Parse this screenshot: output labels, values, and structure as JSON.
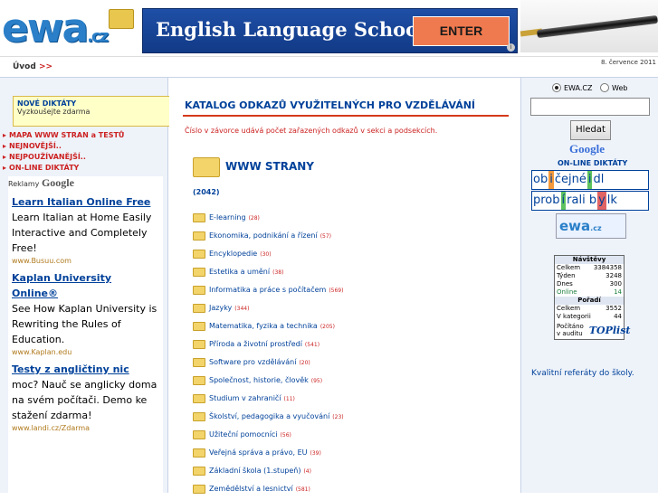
{
  "header": {
    "logo_text": "ewa",
    "logo_suffix": ".cz",
    "banner_title": "English Language School",
    "banner_button": "ENTER",
    "banner_info": "i"
  },
  "subbar": {
    "breadcrumb": "Úvod",
    "breadcrumb_arrows": ">>",
    "date": "8. července 2011"
  },
  "left": {
    "promo_title": "NOVÉ DIKTÁTY",
    "promo_text": "Vyzkoušejte zdarma",
    "menu": [
      "MAPA WWW STRAN a TESTŮ",
      "NEJNOVĚJŠÍ..",
      "NEJPOUŽÍVANĚJŠÍ..",
      "ON-LINE DIKTÁTY"
    ],
    "ads_label": "Reklamy",
    "ads_brand": "Google",
    "ads": [
      {
        "headline": "Learn Italian Online Free",
        "body": "Learn Italian at Home Easily Interactive and Completely Free!",
        "url": "www.Busuu.com"
      },
      {
        "headline": "Kaplan University Online®",
        "body": "See How Kaplan University is Rewriting the Rules of Education.",
        "url": "www.Kaplan.edu"
      },
      {
        "headline": "Testy z angličtiny nic",
        "body": "moc? Nauč se anglicky doma na svém počítači. Demo ke stažení zdarma!",
        "url": "www.landi.cz/Zdarma"
      }
    ]
  },
  "main": {
    "heading": "KATALOG ODKAZŮ VYUŽITELNÝCH PRO VZDĚLÁVÁNÍ",
    "note": "Číslo v závorce udává počet zařazených odkazů v sekci a podsekcích.",
    "section_title": "WWW STRANY",
    "section_count": "(2042)",
    "categories": [
      {
        "name": "E-learning",
        "count": "(28)"
      },
      {
        "name": "Ekonomika, podnikání a řízení",
        "count": "(57)"
      },
      {
        "name": "Encyklopedie",
        "count": "(30)"
      },
      {
        "name": "Estetika a umění",
        "count": "(38)"
      },
      {
        "name": "Informatika a práce s počítačem",
        "count": "(569)"
      },
      {
        "name": "Jazyky",
        "count": "(344)"
      },
      {
        "name": "Matematika, fyzika a technika",
        "count": "(205)"
      },
      {
        "name": "Příroda a životní prostředí",
        "count": "(541)"
      },
      {
        "name": "Software pro vzdělávání",
        "count": "(20)"
      },
      {
        "name": "Společnost, historie, člověk",
        "count": "(95)"
      },
      {
        "name": "Studium v zahraničí",
        "count": "(11)"
      },
      {
        "name": "Školství, pedagogika a vyučování",
        "count": "(23)"
      },
      {
        "name": "Užiteční pomocníci",
        "count": "(56)"
      },
      {
        "name": "Veřejná správa a právo, EU",
        "count": "(39)"
      },
      {
        "name": "Základní škola (1.stupeň)",
        "count": "(4)"
      },
      {
        "name": "Zemědělství a lesnictví",
        "count": "(581)"
      }
    ]
  },
  "right": {
    "radio1": "EWA.CZ",
    "radio2": "Web",
    "search_value": "",
    "search_button": "Hledat",
    "google": "Google",
    "online_title": "ON-LINE DIKTÁTY",
    "tile_row1": [
      "ob",
      "i",
      "čejné ",
      "b",
      "",
      "i",
      "dl"
    ],
    "tile_row2": [
      "prob",
      "í",
      "rali b",
      "y",
      "lk"
    ],
    "ewa_small": "ewa",
    "ewa_small_suffix": ".cz",
    "stats": {
      "visits_header": "Návštěvy",
      "rows1": [
        {
          "label": "Celkem",
          "value": "3384358"
        },
        {
          "label": "Týden",
          "value": "3248"
        },
        {
          "label": "Dnes",
          "value": "300"
        },
        {
          "label": "Online",
          "value": "14"
        }
      ],
      "rank_header": "Pořadí",
      "rows2": [
        {
          "label": "Celkem",
          "value": "3552"
        },
        {
          "label": "V kategorii",
          "value": "44"
        }
      ],
      "footer": "Počítáno v auditu",
      "footer_brand": "TOPlist"
    },
    "promo_link": "Kvalitní referáty do školy."
  }
}
